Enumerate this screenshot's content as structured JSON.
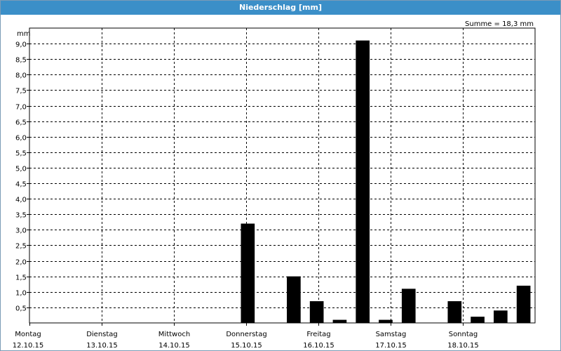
{
  "window": {
    "title": "Niederschlag [mm]"
  },
  "chart_data": {
    "type": "bar",
    "title": "Niederschlag [mm]",
    "unit_label": "mm",
    "summary": "Summe = 18,3 mm",
    "ylim": [
      0,
      9.5
    ],
    "yticks": [
      "0,5",
      "1,0",
      "1,5",
      "2,0",
      "2,5",
      "3,0",
      "3,5",
      "4,0",
      "4,5",
      "5,0",
      "5,5",
      "6,0",
      "6,5",
      "7,0",
      "7,5",
      "8,0",
      "8,5",
      "9,0"
    ],
    "grid": true,
    "days": [
      {
        "name": "Montag",
        "date": "12.10.15"
      },
      {
        "name": "Dienstag",
        "date": "13.10.15"
      },
      {
        "name": "Mittwoch",
        "date": "14.10.15"
      },
      {
        "name": "Donnerstag",
        "date": "15.10.15"
      },
      {
        "name": "Freitag",
        "date": "16.10.15"
      },
      {
        "name": "Samstag",
        "date": "17.10.15"
      },
      {
        "name": "Sonntag",
        "date": "18.10.15"
      }
    ],
    "values": [
      0,
      0,
      0,
      0,
      0,
      0,
      0,
      0,
      0,
      3.2,
      0,
      1.5,
      0.7,
      0.1,
      9.1,
      0.1,
      1.1,
      0,
      0.7,
      0.2,
      0.4,
      1.2
    ],
    "bar_color": "#000000",
    "grid_color": "#000000"
  }
}
